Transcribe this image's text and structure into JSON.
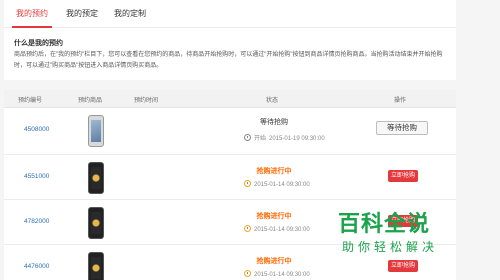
{
  "tabs": [
    {
      "label": "我的预约",
      "active": true
    },
    {
      "label": "我的预定",
      "active": false
    },
    {
      "label": "我的定制",
      "active": false
    }
  ],
  "info": {
    "title": "什么是我的预约",
    "text": "商品预约后，在\"我的预约\"栏目下，您可以查看在您预约的商品，待商品开始抢购时，可以通过\"开始抢购\"按钮到商品详情页抢购商品。当抢购活动结束并开始抢购时，可以通过\"购买商品\"按钮进入商品详情页购买商品。"
  },
  "table": {
    "headers": [
      "预约编号",
      "预约商品",
      "预约时间",
      "状态",
      "操作"
    ],
    "rows": [
      {
        "order_no": "4508000",
        "status": "等待抢购",
        "time_label": "开始",
        "time": "2015-01-19 09:30:00",
        "action": "等待抢购",
        "phone": "silver"
      },
      {
        "order_no": "4551000",
        "status": "抢购进行中",
        "time_label": "",
        "time": "2015-01-14 09:30:00",
        "action": "立即抢购",
        "phone": "gold"
      },
      {
        "order_no": "4782000",
        "status": "抢购进行中",
        "time_label": "",
        "time": "2015-01-14 09:30:00",
        "action": "立即抢购",
        "phone": "gold"
      },
      {
        "order_no": "4476000",
        "status": "抢购进行中",
        "time_label": "",
        "time": "2015-01-14 09:30:00",
        "action": "立即抢购",
        "phone": "gold"
      }
    ]
  },
  "watermark": {
    "logo": "百科全说",
    "sub": "助你轻松解决"
  },
  "colors": {
    "accent": "#e4393c",
    "link": "#2a6cb7",
    "live": "#ff6a00",
    "watermark": "#1aa34a"
  }
}
